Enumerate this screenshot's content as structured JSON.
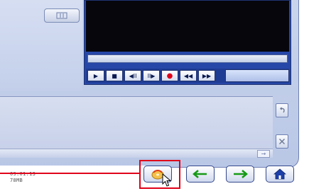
{
  "status": {
    "date": "09.01.13",
    "size": "78MB"
  },
  "player": {
    "controls": [
      {
        "name": "play-icon",
        "glyph": "▶"
      },
      {
        "name": "stop-icon",
        "glyph": "■"
      },
      {
        "name": "step-back-icon",
        "glyph": "◀II"
      },
      {
        "name": "step-forward-icon",
        "glyph": "II▶"
      },
      {
        "name": "record-icon",
        "glyph": "●"
      },
      {
        "name": "rewind-icon",
        "glyph": "◀◀"
      },
      {
        "name": "fast-forward-icon",
        "glyph": "▶▶"
      }
    ]
  },
  "buttons": {
    "burn": "burn-disc-icon",
    "back": "arrow-left-icon",
    "forward": "arrow-right-icon",
    "home": "home-icon"
  },
  "colors": {
    "accent": "#e0001a",
    "player_blue": "#1f3c94",
    "window_bg": "#c9d4ec",
    "nav_arrow": "#159a15"
  }
}
